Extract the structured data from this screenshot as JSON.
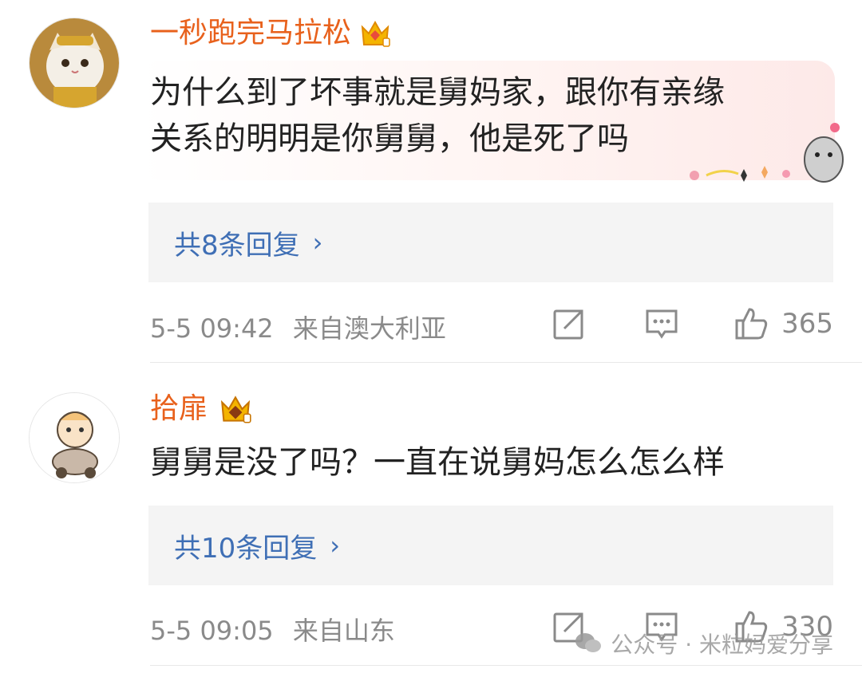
{
  "comments": [
    {
      "username": "一秒跑完马拉松",
      "text": "为什么到了坏事就是舅妈家，跟你有亲缘\n关系的明明是你舅舅，他是死了吗",
      "replies_label": "共8条回复",
      "time": "5-5 09:42",
      "location": "来自澳大利亚",
      "likes": "365"
    },
    {
      "username": "拾扉",
      "text": "舅舅是没了吗？一直在说舅妈怎么怎么样",
      "replies_label": "共10条回复",
      "time": "5-5 09:05",
      "location": "来自山东",
      "likes": "330"
    }
  ],
  "watermark": "公众号 · 米粒妈爱分享",
  "colors": {
    "username": "#e8611c",
    "link": "#3f6fb5",
    "meta": "#8a8a8a",
    "reply_bg": "#f4f4f4"
  }
}
